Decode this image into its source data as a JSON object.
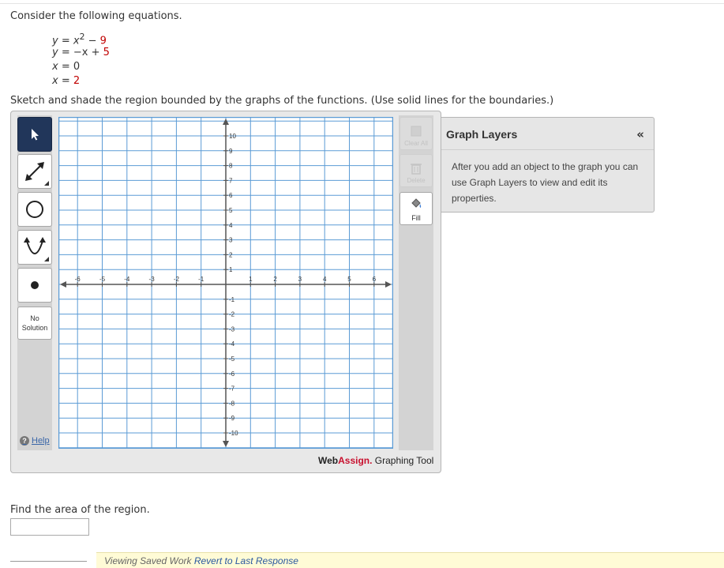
{
  "question": {
    "intro": "Consider the following equations.",
    "equations": [
      {
        "lhs": "y",
        "op": " = ",
        "rhs_main": "x",
        "sup": "2",
        "tail": " − ",
        "const": "9"
      },
      {
        "lhs": "y",
        "op": " = ",
        "rhs_main": "−x + ",
        "sup": "",
        "tail": "",
        "const": "5"
      },
      {
        "lhs": "x",
        "op": " = ",
        "rhs_main": "0",
        "sup": "",
        "tail": "",
        "const": ""
      },
      {
        "lhs": "x",
        "op": " = ",
        "rhs_main": "2",
        "sup": "",
        "tail": "",
        "const": ""
      }
    ],
    "instruction": "Sketch and shade the region bounded by the graphs of the functions. (Use solid lines for the boundaries.)",
    "area_prompt": "Find the area of the region."
  },
  "tool": {
    "left_tools": [
      {
        "name": "select-tool-button",
        "icon": "arrow-pointer-icon",
        "selected": true
      },
      {
        "name": "line-tool-button",
        "icon": "double-arrow-line-icon",
        "selected": false
      },
      {
        "name": "circle-tool-button",
        "icon": "circle-icon",
        "selected": false
      },
      {
        "name": "parabola-tool-button",
        "icon": "parabola-icon",
        "selected": false
      },
      {
        "name": "point-tool-button",
        "icon": "point-icon",
        "selected": false
      }
    ],
    "no_solution_line1": "No",
    "no_solution_line2": "Solution",
    "help_label": "Help",
    "clear_all_label": "Clear All",
    "delete_label": "Delete",
    "fill_label": "Fill",
    "brand_web": "Web",
    "brand_assign": "Assign.",
    "brand_rest": " Graphing Tool",
    "colors": {
      "selected": "#21365a",
      "grid": "#5b9bd5",
      "axis": "#555555",
      "brand_red": "#c8102e"
    }
  },
  "graph": {
    "x_ticks": [
      "-6",
      "-5",
      "-4",
      "-3",
      "-2",
      "-1",
      "1",
      "2",
      "3",
      "4",
      "5",
      "6"
    ],
    "y_ticks": [
      "10",
      "9",
      "8",
      "7",
      "6",
      "5",
      "4",
      "3",
      "2",
      "1",
      "-1",
      "-2",
      "-3",
      "-4",
      "-5",
      "-6",
      "-7",
      "-8",
      "-9",
      "-10"
    ]
  },
  "layers": {
    "title": "Graph Layers",
    "collapse_symbol": "«",
    "text": "After you add an object to the graph you can use Graph Layers to view and edit its properties."
  },
  "status": {
    "saved_prefix": "Viewing Saved Work ",
    "revert_link": "Revert to Last Response"
  }
}
